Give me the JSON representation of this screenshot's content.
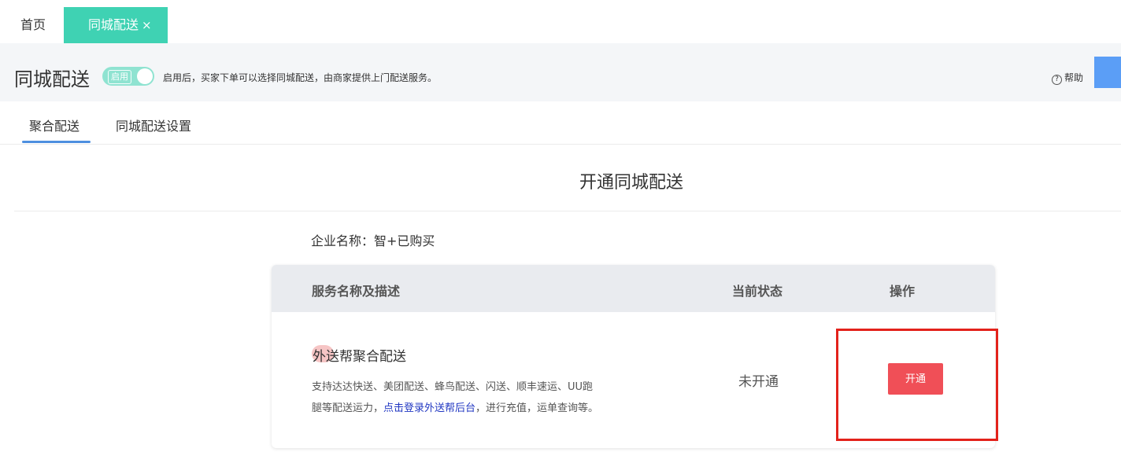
{
  "tabs": {
    "home": "首页",
    "active": "同城配送",
    "close": "×"
  },
  "header": {
    "title": "同城配送",
    "toggle_label": "启用",
    "description": "启用后，买家下单可以选择同城配送，由商家提供上门配送服务。",
    "help_icon": "?",
    "help_label": "帮助"
  },
  "subtabs": [
    {
      "label": "聚合配送",
      "active": true
    },
    {
      "label": "同城配送设置",
      "active": false
    }
  ],
  "section": {
    "title": "开通同城配送",
    "company": "企业名称：智+已购买"
  },
  "table": {
    "headers": [
      "服务名称及描述",
      "当前状态",
      "操作"
    ],
    "rows": [
      {
        "name": "外送帮聚合配送",
        "desc_line1": "支持达达快送、美团配送、蜂鸟配送、闪送、顺丰速运、UU跑",
        "desc_line2_pre": "腿等配送运力，",
        "desc_link": "点击登录外送帮后台",
        "desc_line2_post": "，进行充值，运单查询等。",
        "status": "未开通",
        "action": "开通"
      }
    ]
  },
  "colors": {
    "accent_tab": "#3fd2b3",
    "toggle": "#8fe3d1",
    "primary_button": "#f04f57",
    "link": "#2137c2",
    "annotation_box": "#e3221b",
    "underline": "#4e8fe0"
  },
  "icons": {
    "help": "help-circle-icon",
    "close": "close-icon"
  }
}
